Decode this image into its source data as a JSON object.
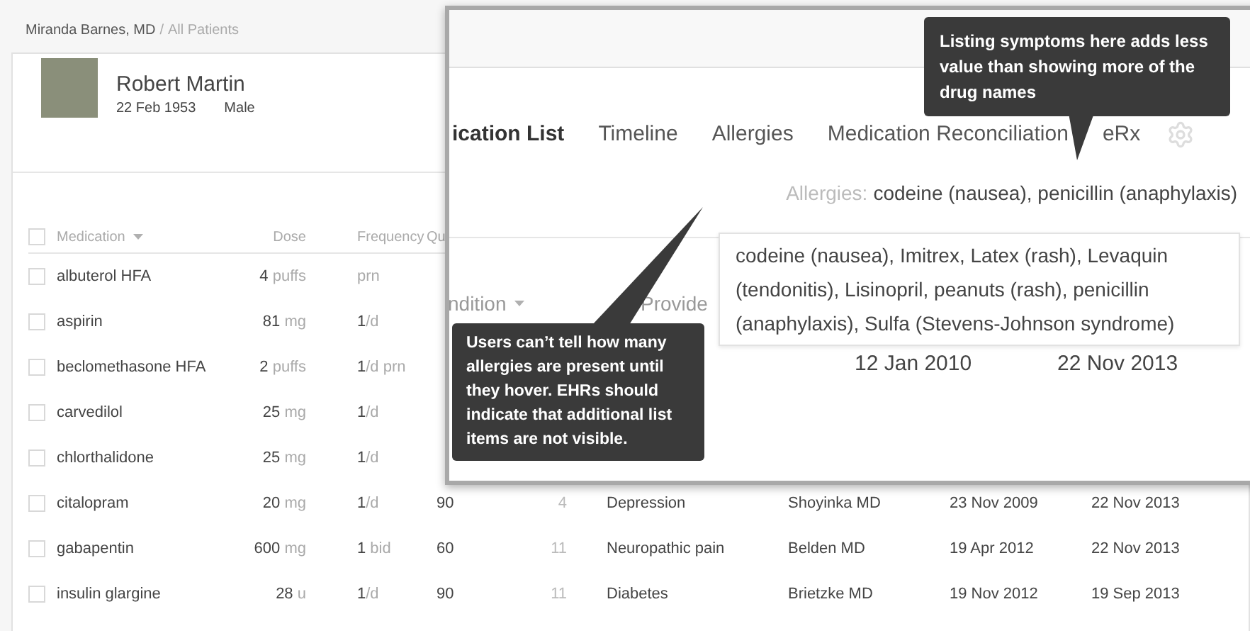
{
  "breadcrumb": {
    "user": "Miranda Barnes, MD",
    "separator": "/",
    "page": "All Patients"
  },
  "patient": {
    "name": "Robert Martin",
    "dob": "22 Feb 1953",
    "sex": "Male"
  },
  "table": {
    "select_all_checked": false,
    "columns": [
      {
        "label": "Medication",
        "sort": true
      },
      {
        "label": "Dose"
      },
      {
        "label": "Frequency"
      },
      {
        "label": "Qu"
      }
    ],
    "rows": [
      {
        "checked": false,
        "medication": "albuterol HFA",
        "dose": {
          "amount": "4",
          "unit": "puffs"
        },
        "frequency": {
          "unit": "prn"
        }
      },
      {
        "checked": false,
        "medication": "aspirin",
        "dose": {
          "amount": "81",
          "unit": "mg"
        },
        "frequency": {
          "count": "1",
          "unit": "/d"
        }
      },
      {
        "checked": false,
        "medication": "beclomethasone HFA",
        "dose": {
          "amount": "2",
          "unit": "puffs"
        },
        "frequency": {
          "count": "1",
          "unit": "/d prn"
        }
      },
      {
        "checked": false,
        "medication": "carvedilol",
        "dose": {
          "amount": "25",
          "unit": "mg"
        },
        "frequency": {
          "count": "1",
          "unit": "/d"
        }
      },
      {
        "checked": false,
        "medication": "chlorthalidone",
        "dose": {
          "amount": "25",
          "unit": "mg"
        },
        "frequency": {
          "count": "1",
          "unit": "/d"
        }
      },
      {
        "checked": false,
        "medication": "citalopram",
        "dose": {
          "amount": "20",
          "unit": "mg"
        },
        "frequency": {
          "count": "1",
          "unit": "/d"
        },
        "quantity": "90",
        "refills": "4",
        "condition": "Depression",
        "provider": "Shoyinka MD",
        "start": "23 Nov 2009",
        "last": "22 Nov 2013"
      },
      {
        "checked": false,
        "medication": "gabapentin",
        "dose": {
          "amount": "600",
          "unit": "mg"
        },
        "frequency": {
          "count": "1",
          "unit": " bid"
        },
        "quantity": "60",
        "refills": "11",
        "condition": "Neuropathic pain",
        "provider": "Belden MD",
        "start": "19 Apr 2012",
        "last": "22 Nov 2013"
      },
      {
        "checked": false,
        "medication": "insulin glargine",
        "dose": {
          "amount": "28",
          "unit": "u"
        },
        "frequency": {
          "count": "1",
          "unit": "/d"
        },
        "quantity": "90",
        "refills": "11",
        "condition": "Diabetes",
        "provider": "Brietzke MD",
        "start": "19 Nov 2012",
        "last": "19 Sep 2013"
      }
    ]
  },
  "magnified": {
    "tabs": [
      {
        "label": "ication List",
        "selected": true
      },
      {
        "label": "Timeline",
        "selected": false
      },
      {
        "label": "Allergies",
        "selected": false
      },
      {
        "label": "Medication Reconciliation",
        "selected": false
      },
      {
        "label": "eRx",
        "selected": false
      }
    ],
    "allergies_label": "Allergies:",
    "allergies_summary": "codeine (nausea), penicillin (anaphylaxis)",
    "allergies_popup": "codeine (nausea), Imitrex, Latex (rash), Levaquin (tendonitis), Lisinopril, peanuts (rash), penicillin (anaphylaxis), Sulfa (Stevens-Johnson syndrome)",
    "columns": [
      {
        "label": "ndition",
        "sort": true
      },
      {
        "label": "Provide"
      }
    ],
    "row": {
      "start": "12 Jan 2010",
      "last": "22 Nov 2013"
    }
  },
  "callouts": [
    "Listing symptoms here adds less value than showing more of the drug names",
    "Users can’t tell how many allergies are present until they hover. EHRs should indicate that additional list items are not visible."
  ]
}
